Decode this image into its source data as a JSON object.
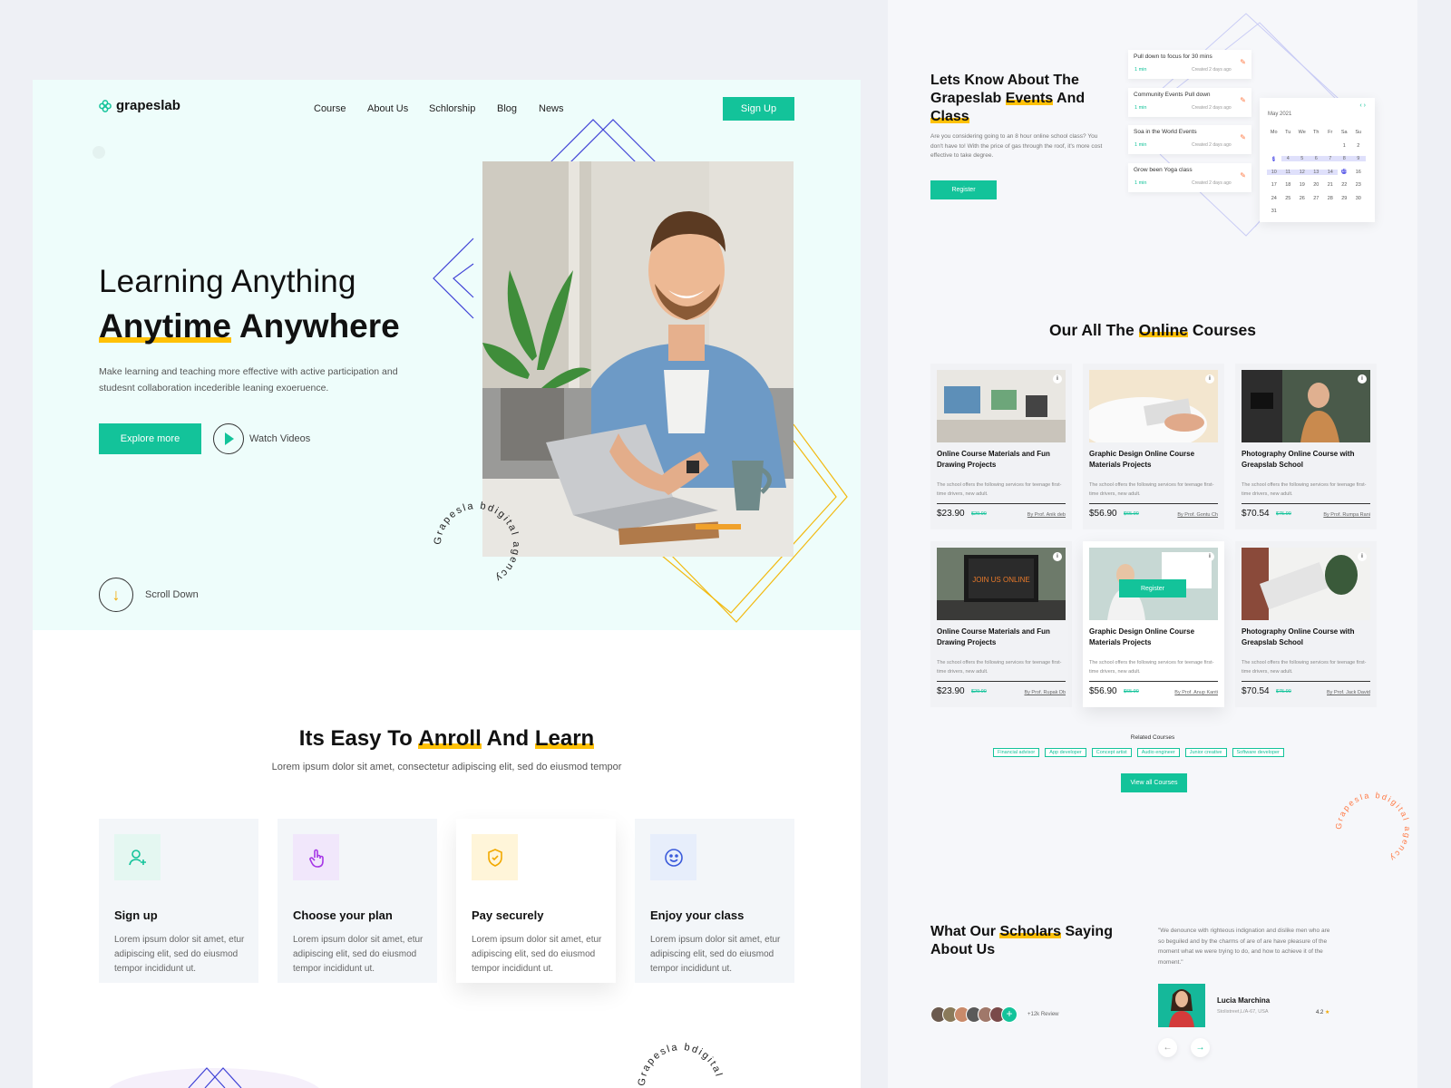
{
  "brand": {
    "name": "grapeslab",
    "accent": "#13c39a",
    "highlight": "#ffc107",
    "calendar_accent": "#5b5be8"
  },
  "nav": {
    "items": [
      "Course",
      "About Us",
      "Schlorship",
      "Blog",
      "News"
    ],
    "cta": "Sign Up"
  },
  "hero": {
    "line1": "Learning Anything",
    "line2a": "Anytime",
    "line2b": "Anywhere",
    "description": "Make learning and teaching more effective with active participation and studesnt collaboration incederible leaning exoeruence.",
    "explore": "Explore more",
    "watch": "Watch Videos",
    "scroll": "Scroll Down",
    "badge_text": "Grapesla bdigital agency"
  },
  "steps": {
    "title_a": "Its Easy To",
    "title_b": "Anroll",
    "title_c": "And",
    "title_d": "Learn",
    "subtitle": "Lorem ipsum dolor sit amet, consectetur adipiscing elit, sed do eiusmod tempor",
    "cards": [
      {
        "title": "Sign up",
        "desc": "Lorem ipsum dolor sit amet, etur adipiscing elit, sed do eiusmod tempor incididunt ut.",
        "icon": "user-plus-icon",
        "bg": "#e4f7f1"
      },
      {
        "title": "Choose your plan",
        "desc": "Lorem ipsum dolor sit amet, etur adipiscing elit, sed do eiusmod tempor incididunt ut.",
        "icon": "hand-pointer-icon",
        "bg": "#f1e7fb"
      },
      {
        "title": "Pay securely",
        "desc": "Lorem ipsum dolor sit amet, etur adipiscing elit, sed do eiusmod tempor incididunt ut.",
        "icon": "shield-check-icon",
        "bg": "#fff5d9"
      },
      {
        "title": "Enjoy your class",
        "desc": "Lorem ipsum dolor sit amet, etur adipiscing elit, sed do eiusmod tempor incididunt ut.",
        "icon": "smiley-icon",
        "bg": "#e7eefb"
      }
    ]
  },
  "events": {
    "title_a": "Lets Know About The Grapeslab",
    "title_b": "Events",
    "title_c": "And",
    "title_d": "Class",
    "description": "Are you considering going to an 8 hour online school class? You don't have to! With the price of gas through the roof, it's more cost effective to take degree.",
    "register": "Register",
    "tasks": [
      {
        "title": "Pull down to focus for 30 mins",
        "time": "1 min",
        "created": "Created 2 days ago"
      },
      {
        "title": "Community Events Pull down",
        "time": "1 min",
        "created": "Created 2 days ago"
      },
      {
        "title": "Soa in the World Events",
        "time": "1 min",
        "created": "Created 2 days ago"
      },
      {
        "title": "Grow been Yoga class",
        "time": "1 min",
        "created": "Created 2 days ago"
      }
    ],
    "calendar": {
      "month": "May 2021",
      "days": [
        "Mo",
        "Tu",
        "We",
        "Th",
        "Fr",
        "Sa",
        "Su"
      ],
      "dates": [
        "",
        "",
        "",
        "",
        "",
        "1",
        "2",
        "3",
        "4",
        "5",
        "6",
        "7",
        "8",
        "9",
        "10",
        "11",
        "12",
        "13",
        "14",
        "15",
        "16",
        "17",
        "18",
        "19",
        "20",
        "21",
        "22",
        "23",
        "24",
        "25",
        "26",
        "27",
        "28",
        "29",
        "30",
        "31"
      ],
      "range_start": "3",
      "range_end": "15"
    }
  },
  "courses": {
    "title_a": "Our All The",
    "title_b": "Online",
    "title_c": "Courses",
    "items": [
      {
        "name": "Online Course Materials and Fun Drawing Projects",
        "desc": "The school offers the following services for teenage first-time drivers, new adult.",
        "price": "$23.90",
        "old": "$29.90",
        "by": "By Prof. Anik deb"
      },
      {
        "name": "Graphic Design Online Course Materials Projects",
        "desc": "The school offers the following services for teenage first-time drivers, new adult.",
        "price": "$56.90",
        "old": "$65.90",
        "by": "By Prof. Gontu Ch"
      },
      {
        "name": "Photography Online Course with Greapslab School",
        "desc": "The school offers the following services for teenage first-time drivers, new adult.",
        "price": "$70.54",
        "old": "$75.90",
        "by": "By Prof. Rumpa Rani"
      },
      {
        "name": "Online Course Materials and Fun Drawing Projects",
        "desc": "The school offers the following services for teenage first-time drivers, new adult.",
        "price": "$23.90",
        "old": "$29.90",
        "by": "By Prof. Rupak Db"
      },
      {
        "name": "Graphic Design Online Course Materials Projects",
        "desc": "The school offers the following services for teenage first-time drivers, new adult.",
        "price": "$56.90",
        "old": "$65.90",
        "by": "By Prof. Anup Kanti"
      },
      {
        "name": "Photography Online Course with Greapslab School",
        "desc": "The school offers the following services for teenage first-time drivers, new adult.",
        "price": "$70.54",
        "old": "$75.90",
        "by": "By Prof. Jack David"
      }
    ],
    "card_register": "Register",
    "laptop_text": "JOIN US ONLINE",
    "related_label": "Related Courses",
    "tags": [
      "Financial advisor",
      "App developer",
      "Concept artist",
      "Audio engineer",
      "Junior creative",
      "Software developer"
    ],
    "view_all": "View all Courses"
  },
  "testimonials": {
    "title_a": "What Our",
    "title_b": "Scholars",
    "title_c": "Saying About Us",
    "reviews": "+12k Review",
    "quote": "\"We denounce with righteous indignation and dislike men who are so beguiled and by the charms of are of are have pleasure of the moment what we were trying to do, and how to achieve it of the moment.\"",
    "name": "Lucia Marchina",
    "location": "Stolistreet,L/A-67, USA",
    "rating": "4.2",
    "star": "★"
  }
}
